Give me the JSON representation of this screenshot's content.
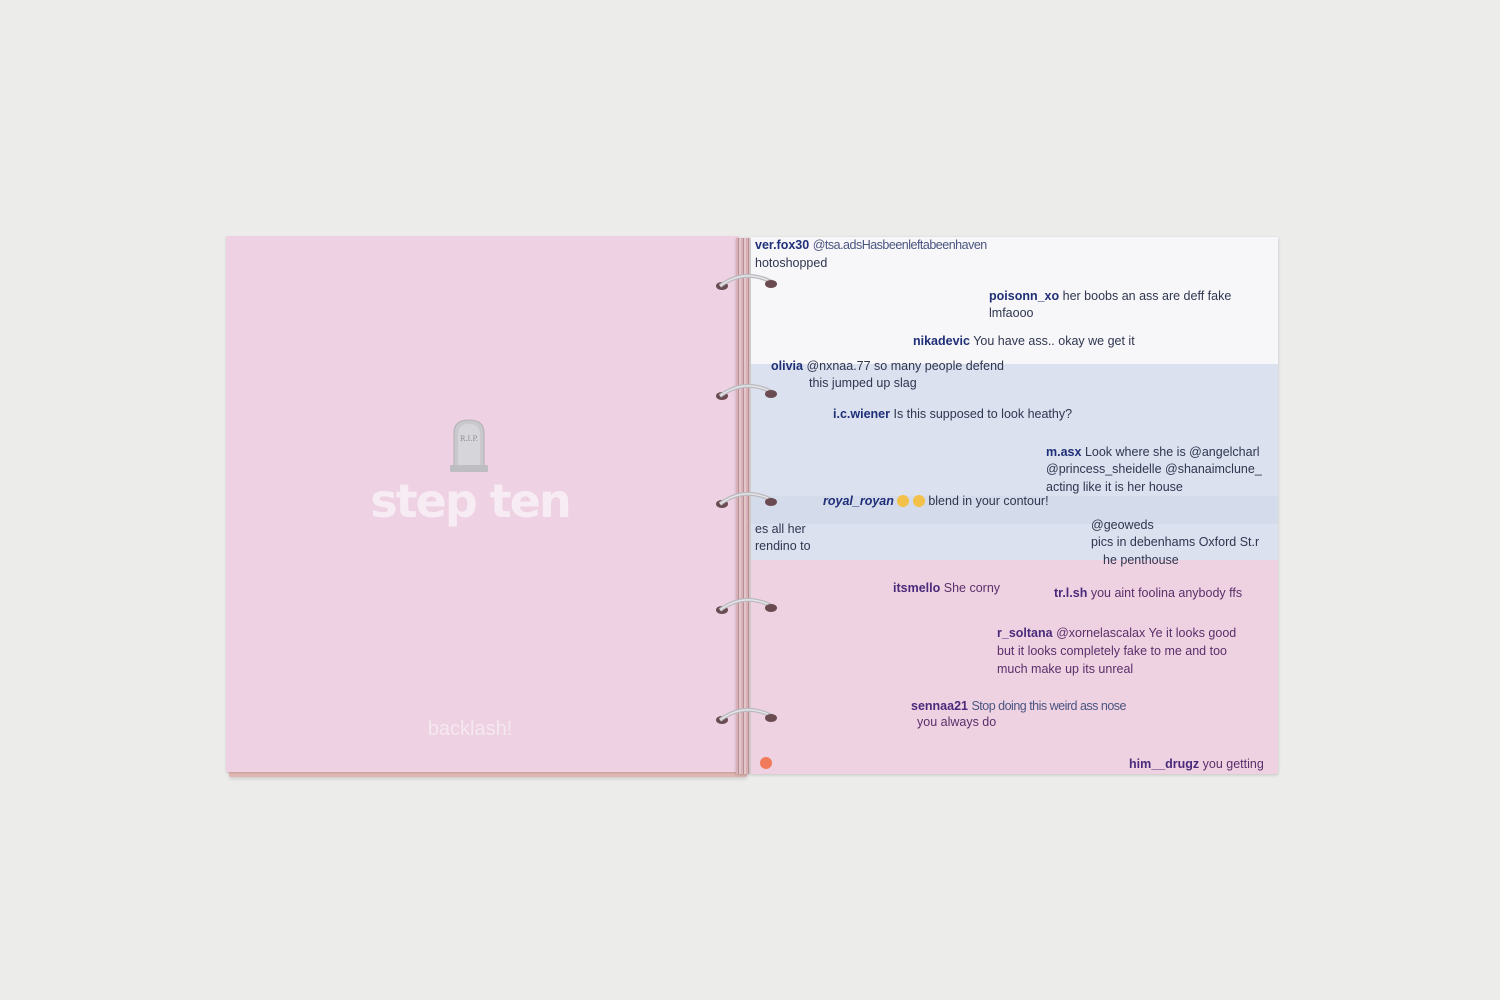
{
  "left_page": {
    "tombstone_icon": "rip-tombstone-icon",
    "tombstone_text": "R.I.P.",
    "title": "step ten",
    "footer": "backlash!"
  },
  "right_page": {
    "comments": [
      {
        "user": "ver.fox30",
        "text": "@tsa.adsHasbeenleftabeenhaven"
      },
      {
        "user": "",
        "text": "hotoshopped"
      },
      {
        "user": "poisonn_xo",
        "text": "her boobs an ass are deff fake"
      },
      {
        "user": "",
        "text": "lmfaooo"
      },
      {
        "user": "nikadevic",
        "text": "You have ass.. okay we get it"
      },
      {
        "user": "olivia",
        "text": "@nxnaa.77 so many people defend"
      },
      {
        "user": "",
        "text": "this jumped up slag"
      },
      {
        "user": "i.c.wiener",
        "text": "Is this supposed to look heathy?"
      },
      {
        "user": "m.asx",
        "text": "Look where she is @angelcharl"
      },
      {
        "user": "",
        "text": "@princess_sheidelle @shanaimclune_"
      },
      {
        "user": "",
        "text": "acting like it is her house"
      },
      {
        "user": "royal_royan",
        "text": "blend in your contour!"
      },
      {
        "user": "",
        "text": "es all her"
      },
      {
        "user": "",
        "text": "rendino to"
      },
      {
        "user": "",
        "text": "@geoweds"
      },
      {
        "user": "",
        "text": "pics in debenhams Oxford St.r"
      },
      {
        "user": "",
        "text": "he penthouse"
      },
      {
        "user": "itsmello",
        "text": "She corny"
      },
      {
        "user": "tr.l.sh",
        "text": "you aint foolina anybody ffs"
      },
      {
        "user": "r_soltana",
        "text": "@xornelascalax Ye it looks good"
      },
      {
        "user": "",
        "text": "but it looks completely fake to me and too"
      },
      {
        "user": "",
        "text": "much make up its unreal"
      },
      {
        "user": "sennaa21",
        "text": "Stop doing this weird ass nose"
      },
      {
        "user": "",
        "text": "you always do"
      },
      {
        "user": "him__drugz",
        "text": "you getting"
      }
    ]
  },
  "colors": {
    "background": "#ececeb",
    "left_page": "#eed1e2",
    "right_page_pink": "#efd2e2",
    "right_page_blue": "#dbe1ee",
    "right_page_white": "#f7f6f8",
    "username": "#1f2f78"
  },
  "binder_rings": {
    "count": 5,
    "icon": "metal-binder-ring-icon"
  }
}
